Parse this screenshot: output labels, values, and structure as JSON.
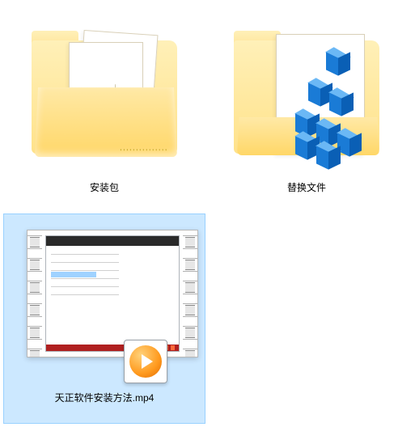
{
  "items": [
    {
      "label": "安装包"
    },
    {
      "label": "替换文件"
    },
    {
      "label": "天正软件安装方法.mp4"
    }
  ]
}
